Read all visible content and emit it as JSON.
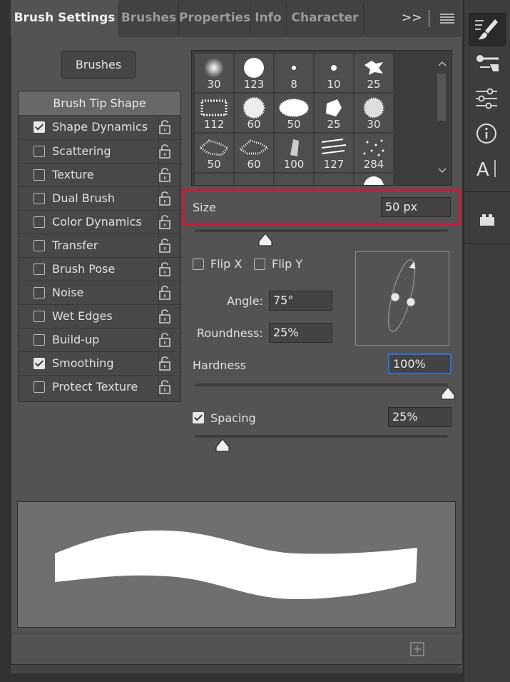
{
  "tabs": [
    "Brush Settings",
    "Brushes",
    "Properties",
    "Info",
    "Character"
  ],
  "tab_overflow": ">>",
  "brushes_button": "Brushes",
  "tip_shape_label": "Brush Tip Shape",
  "options": [
    {
      "label": "Shape Dynamics",
      "checked": true
    },
    {
      "label": "Scattering",
      "checked": false
    },
    {
      "label": "Texture",
      "checked": false
    },
    {
      "label": "Dual Brush",
      "checked": false
    },
    {
      "label": "Color Dynamics",
      "checked": false
    },
    {
      "label": "Transfer",
      "checked": false
    },
    {
      "label": "Brush Pose",
      "checked": false
    },
    {
      "label": "Noise",
      "checked": false
    },
    {
      "label": "Wet Edges",
      "checked": false
    },
    {
      "label": "Build-up",
      "checked": false
    },
    {
      "label": "Smoothing",
      "checked": true
    },
    {
      "label": "Protect Texture",
      "checked": false
    }
  ],
  "presets": [
    "30",
    "123",
    "8",
    "10",
    "25",
    "112",
    "60",
    "50",
    "25",
    "30",
    "50",
    "60",
    "100",
    "127",
    "284"
  ],
  "size": {
    "label": "Size",
    "value": "50 px"
  },
  "flip_x": "Flip X",
  "flip_y": "Flip Y",
  "angle": {
    "label": "Angle:",
    "value": "75°"
  },
  "roundness": {
    "label": "Roundness:",
    "value": "25%"
  },
  "hardness": {
    "label": "Hardness",
    "value": "100%"
  },
  "spacing": {
    "label": "Spacing",
    "value": "25%",
    "checked": true
  },
  "sliders": {
    "size": 0.28,
    "hardness": 1.0,
    "spacing": 0.11
  },
  "colors": {
    "highlight": "#d4163c",
    "panel": "#535353",
    "preview_bg": "#6f6f6f",
    "focus": "#2f6fd6"
  },
  "icons": [
    "brush-settings-icon",
    "brush-library-icon",
    "adjustments-icon",
    "info-icon",
    "character-icon",
    "plugin-icon"
  ]
}
